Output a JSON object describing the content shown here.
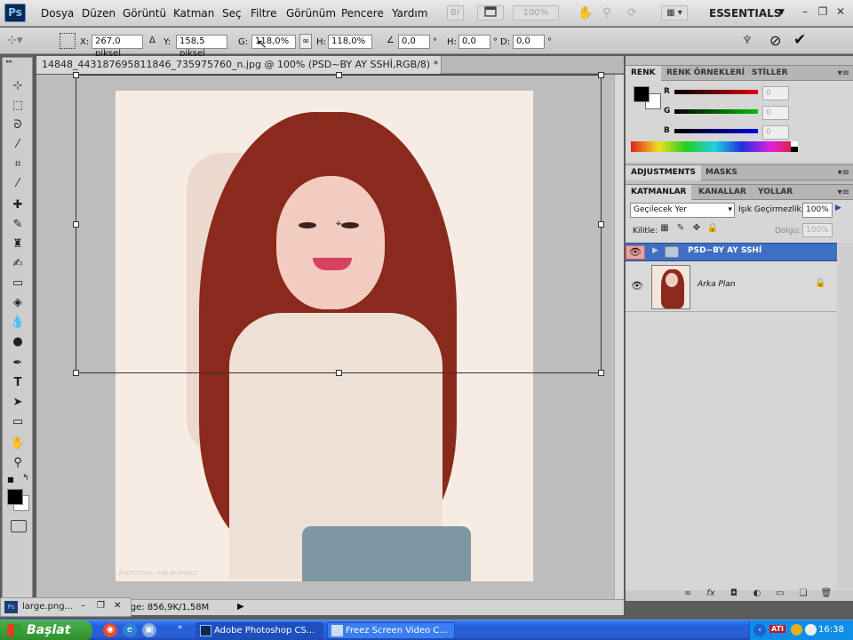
{
  "app": {
    "logo": "Ps"
  },
  "menu": [
    "Dosya",
    "Düzen",
    "Görüntü",
    "Katman",
    "Seç",
    "Filtre",
    "Görünüm",
    "Pencere",
    "Yardım"
  ],
  "toolbar_top": {
    "zoom": "100%",
    "br_label": "Br",
    "workspace": "ESSENTIALS"
  },
  "options": {
    "x_label": "X:",
    "x_value": "267,0 piksel",
    "y_label": "Y:",
    "y_value": "158,5 piksel",
    "w_label": "G:",
    "w_value": "118,0%",
    "h_label": "H:",
    "h_value": "118,0%",
    "angle_value": "0,0",
    "hskew_label": "H:",
    "hskew_value": "0,0",
    "vskew_label": "D:",
    "vskew_value": "0,0",
    "degree": "°"
  },
  "document": {
    "tab_title": "14848_443187695811846_735975760_n.jpg @ 100% (PSD~BY AY SSHİ,RGB/8) *",
    "status": "lge: 856,9K/1,58M",
    "watermark": "PHOTOTOOL~SHB-Ah-PHYELT"
  },
  "color_panel": {
    "tabs": [
      "RENK",
      "RENK ÖRNEKLERİ",
      "STİLLER"
    ],
    "sliders": [
      {
        "label": "R",
        "value": "0",
        "color": "#e00000"
      },
      {
        "label": "G",
        "value": "0",
        "color": "#00c000"
      },
      {
        "label": "B",
        "value": "0",
        "color": "#0000e0"
      }
    ]
  },
  "adjust_tabs": [
    "ADJUSTMENTS",
    "MASKS"
  ],
  "layers_panel": {
    "tabs": [
      "KATMANLAR",
      "KANALLAR",
      "YOLLAR"
    ],
    "blend_mode": "Geçilecek Yer",
    "opacity_label": "Işık Geçirmezlik:",
    "opacity": "100%",
    "lock_label": "Kilitle:",
    "fill_label": "Dolgu:",
    "fill": "100%",
    "layers": [
      {
        "name": "PSD~BY AY SSHİ",
        "type": "group",
        "selected": true
      },
      {
        "name": "Arka Plan",
        "type": "background",
        "selected": false
      }
    ]
  },
  "minimized_doc": "large.png...",
  "taskbar": {
    "start": "Başlat",
    "tasks": [
      "Adobe Photoshop CS...",
      "Freez Screen Video C..."
    ],
    "tray_label": "ATI",
    "clock": "16:38"
  },
  "colors": {
    "selected_layer": "#3d6fc3",
    "taskbar": "#245edb",
    "start": "#3a9b3a",
    "hair": "#8a2a1c"
  }
}
